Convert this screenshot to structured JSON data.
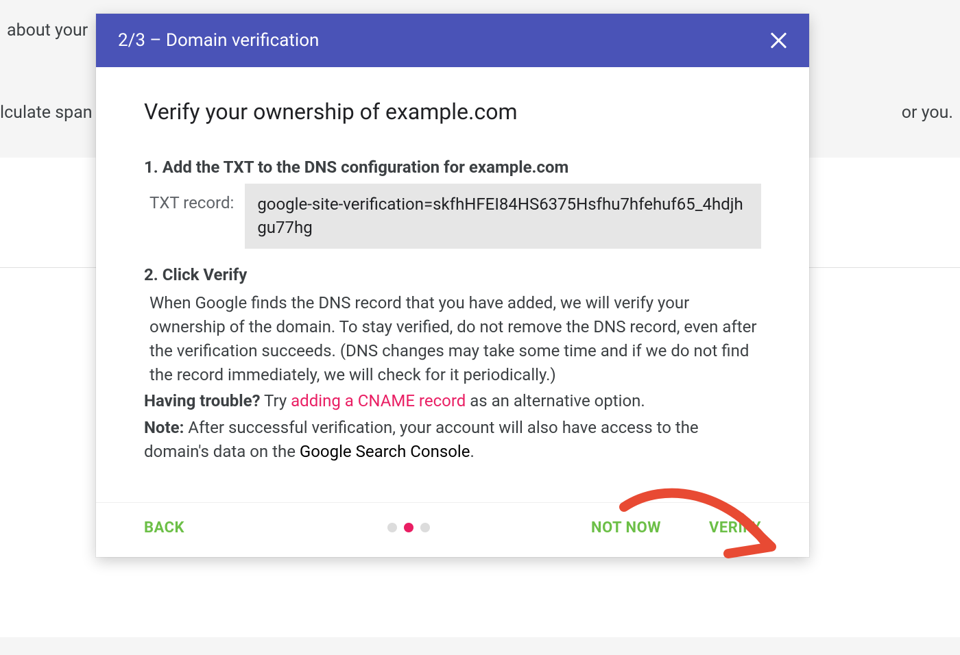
{
  "background": {
    "text1": "about your",
    "text2": "lculate span",
    "text3": "or you."
  },
  "dialog": {
    "header_title": "2/3 – Domain verification",
    "body_title": "Verify your ownership of example.com",
    "step1_heading": "1. Add the TXT to the DNS configuration for example.com",
    "record_label": "TXT record:",
    "record_value": "google-site-verification=skfhHFEI84HS6375Hsfhu7hfehuf65_4hdjhgu77hg",
    "step2_heading": "2. Click Verify",
    "explain": "When Google finds the DNS record that you have added, we will verify your ownership of the domain. To stay verified, do not remove the DNS record, even after the verification succeeds. (DNS changes may take some time and if we do not find the record immediately, we will check for it periodically.)",
    "trouble_strong": "Having trouble?",
    "trouble_try": " Try ",
    "trouble_link": "adding a CNAME record",
    "trouble_tail": " as an alternative option.",
    "note_strong": "Note:",
    "note_text": " After successful verification, your account will also have access to the domain's data on the ",
    "note_gsc": "Google Search Console",
    "note_period": "."
  },
  "footer": {
    "back": "BACK",
    "not_now": "NOT NOW",
    "verify": "VERIFY",
    "steps_total": 3,
    "steps_current": 2
  }
}
